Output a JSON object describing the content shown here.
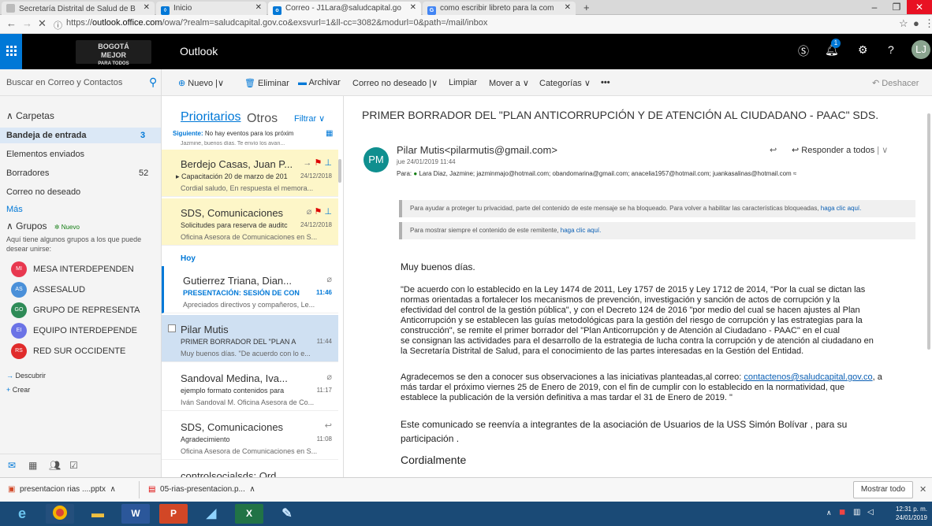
{
  "browser": {
    "tabs": [
      {
        "label": "Secretaría Distrital de Salud de B"
      },
      {
        "label": "Inicio"
      },
      {
        "label": "Correo - J1Lara@saludcapital.go"
      },
      {
        "label": "como escribir libreto para la com"
      }
    ],
    "url_prefix": "https://",
    "url_host": "outlook.office.com",
    "url_path": "/owa/?realm=saludcapital.gov.co&exsvurl=1&ll-cc=3082&modurl=0&path=/mail/inbox"
  },
  "app": {
    "title": "Outlook",
    "logo_line1": "BOGOTÁ",
    "logo_line2": "MEJOR",
    "logo_line3": "PARA TODOS",
    "avatar_initials": "LJ",
    "notif_count": "1"
  },
  "search": {
    "placeholder": "Buscar en Correo y Contactos"
  },
  "commands": {
    "nuevo": "Nuevo",
    "eliminar": "Eliminar",
    "archivar": "Archivar",
    "correo_no_deseado": "Correo no deseado",
    "limpiar": "Limpiar",
    "mover": "Mover a",
    "categorias": "Categorías",
    "more": "•••",
    "deshacer": "Deshacer"
  },
  "folders": {
    "header": "Carpetas",
    "items": [
      {
        "label": "Bandeja de entrada",
        "count": "3"
      },
      {
        "label": "Elementos enviados",
        "count": ""
      },
      {
        "label": "Borradores",
        "count": "52"
      },
      {
        "label": "Correo no deseado",
        "count": ""
      }
    ],
    "more": "Más"
  },
  "groups": {
    "header": "Grupos",
    "new_badge": "Nuevo",
    "hint": "Aquí tiene algunos grupos a los que puede desear unirse:",
    "items": [
      {
        "initials": "MI",
        "name": "MESA INTERDEPENDEN",
        "color": "#e8384f"
      },
      {
        "initials": "AS",
        "name": "ASSESALUD",
        "color": "#4a90d9"
      },
      {
        "initials": "GO",
        "name": "GRUPO DE REPRESENTA",
        "color": "#2e8b57"
      },
      {
        "initials": "EI",
        "name": "EQUIPO INTERDEPENDE",
        "color": "#6b73e6"
      },
      {
        "initials": "RS",
        "name": "RED SUR OCCIDENTE",
        "color": "#e02b2b"
      }
    ],
    "discover": "Descubrir",
    "create": "Crear"
  },
  "list": {
    "tab_focused": "Prioritarios",
    "tab_other": "Otros",
    "filter": "Filtrar",
    "next_label": "Siguiente:",
    "next_text": "No hay eventos para los próxim",
    "cut_preview": "Jazmine, buenos días.  Te envío los avan...",
    "today": "Hoy",
    "messages": [
      {
        "sender": "Berdejo Casas, Juan P...",
        "subject": "Capacitación 20 de marzo de 201",
        "time": "24/12/2018",
        "preview": "Cordial saludo,  En respuesta el memora..."
      },
      {
        "sender": "SDS, Comunicaciones",
        "subject": "Solicitudes para reserva de auditc",
        "time": "24/12/2018",
        "preview": "Oficina Asesora de Comunicaciones en S..."
      },
      {
        "sender": "Gutierrez Triana, Dian...",
        "subject": "PRESENTACIÓN: SESIÓN DE CON",
        "time": "11:46",
        "preview": "Apreciados directivos y compañeros,  Le..."
      },
      {
        "sender": "Pilar Mutis",
        "subject": "PRIMER BORRADOR DEL \"PLAN A",
        "time": "11:44",
        "preview": "Muy buenos días.  \"De acuerdo con lo e..."
      },
      {
        "sender": "Sandoval Medina, Iva...",
        "subject": "ejemplo formato contenidos para",
        "time": "11:17",
        "preview": "Iván Sandoval M. Oficina Asesora de Co..."
      },
      {
        "sender": "SDS, Comunicaciones",
        "subject": "Agradecimiento",
        "time": "11:08",
        "preview": "Oficina Asesora de Comunicaciones en S..."
      },
      {
        "sender": "controlsocialsds; Ord...",
        "subject": "",
        "time": "",
        "preview": ""
      }
    ]
  },
  "reading": {
    "subject": "PRIMER BORRADOR DEL \"PLAN ANTICORRUPCIÓN Y DE ATENCIÓN AL CIUDADANO - PAAC\" SDS.",
    "sender_initials": "PM",
    "sender": "Pilar Mutis<pilarmutis@gmail.com>",
    "date": "jue 24/01/2019 11:44",
    "to_label": "Para:",
    "to": "Lara Diaz, Jazmine; jazminmajo@hotmail.com; obandomarina@gmail.com; anacelia1957@hotmail.com; juankasalinas@hotmail.com",
    "reply_all": "Responder a todos",
    "privacy_text": "Para ayudar a proteger tu privacidad, parte del contenido de este mensaje se ha bloqueado. Para volver a habilitar las características bloqueadas,",
    "privacy_link": "haga clic aquí.",
    "sender_text": "Para mostrar siempre el contenido de este remitente,",
    "sender_link": "haga clic aquí.",
    "greeting": "Muy buenos días.",
    "p1_l1": "\"De acuerdo con lo establecido en la Ley 1474 de 2011, Ley 1757 de 2015 y Ley 1712 de 2014, \"Por la cual se dictan las",
    "p1_l2": "normas orientadas a fortalecer los mecanismos de prevención, investigación y sanción de actos de corrupción y la",
    "p1_l3": "efectividad del control de la gestión pública\", y con el Decreto 124 de 2016 \"por medio del cual se hacen ajustes al Plan",
    "p1_l4": "Anticorrupción y se establecen las guías metodológicas para la gestión del riesgo de corrupción y las estrategias para la",
    "p1_l5": "construcción\", se remite el primer borrador del \"Plan Anticorrupción y de Atención al Ciudadano - PAAC\" en el cual",
    "p1_l6": "se consignan las actividades para el desarrollo de la estrategia de lucha contra la corrupción y de atención al ciudadano en",
    "p1_l7": "la Secretaría Distrital de Salud, para el conocimiento de las partes interesadas en la Gestión del Entidad.",
    "p2_pre": "Agradecemos se den a conocer sus observaciones a las iniciativas planteadas,al correo:",
    "p2_link": "contactenos@saludcapital.gov.co",
    "p2_post": ", a",
    "p2_l2": "más tardar el próximo viernes 25 de Enero de 2019, con el fin de cumplir con lo establecido en la normatividad, que",
    "p2_l3": "establece la publicación de la versión definitiva a mas tardar el 31 de Enero de 2019. \"",
    "p3_l1": "Este comunicado se reenvía a integrantes de la asociación  de Usuarios  de la USS Simón Bolívar , para su",
    "p3_l2": "participación .",
    "closing": "Cordialmente"
  },
  "downloads": {
    "items": [
      {
        "name": "presentacion rias ....pptx"
      },
      {
        "name": "05-rias-presentacion.p..."
      }
    ],
    "show_all": "Mostrar todo"
  },
  "taskbar": {
    "time": "12:31 p. m.",
    "date": "24/01/2019"
  }
}
